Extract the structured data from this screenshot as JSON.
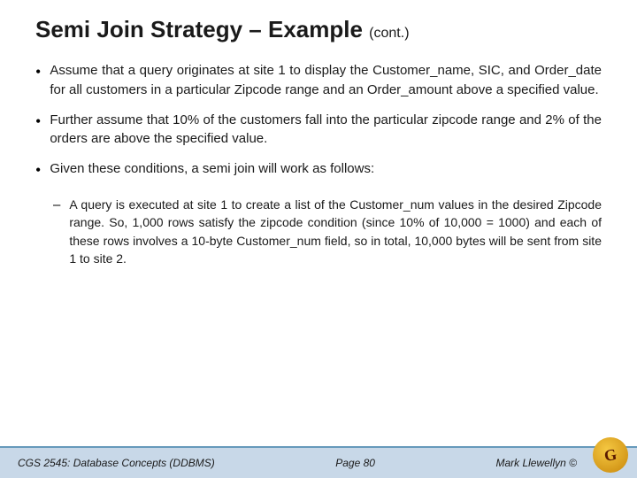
{
  "header": {
    "title": "Semi Join Strategy – Example",
    "subtitle": "(cont.)"
  },
  "bullets": [
    {
      "id": "bullet1",
      "text": "Assume that a query originates at site 1 to display the Customer_name, SIC, and Order_date for all customers in a particular Zipcode range and an Order_amount above a specified value."
    },
    {
      "id": "bullet2",
      "text": "Further assume that 10% of the customers fall into the particular zipcode range and 2% of the orders are above the specified value."
    },
    {
      "id": "bullet3",
      "text": "Given these conditions, a semi join will work as follows:"
    }
  ],
  "sub_bullets": [
    {
      "id": "sub1",
      "text": "A query is executed at site 1 to create a list of the Customer_num values in the desired Zipcode range.  So, 1,000 rows satisfy the zipcode condition (since 10% of 10,000 = 1000) and each of these rows involves a 10-byte Customer_num field, so in total, 10,000 bytes will be sent from site 1 to site 2."
    }
  ],
  "footer": {
    "left": "CGS 2545: Database Concepts  (DDBMS)",
    "center": "Page 80",
    "right": "Mark Llewellyn ©"
  }
}
